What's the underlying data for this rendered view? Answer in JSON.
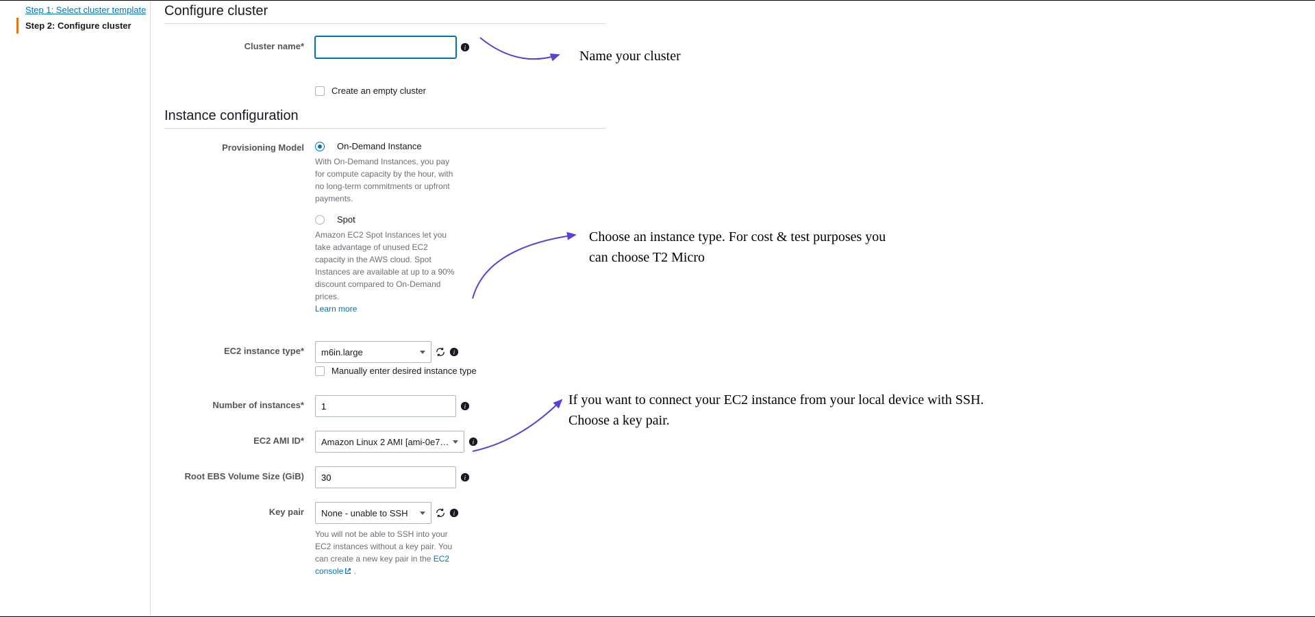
{
  "sidebar": {
    "step1": "Step 1: Select cluster template",
    "step2": "Step 2: Configure cluster"
  },
  "sections": {
    "configure": "Configure cluster",
    "instance": "Instance configuration"
  },
  "clusterName": {
    "label": "Cluster name*"
  },
  "emptyCluster": {
    "label": "Create an empty cluster"
  },
  "provisioning": {
    "label": "Provisioning Model",
    "onDemand": {
      "label": "On-Demand Instance",
      "help": "With On-Demand Instances, you pay for compute capacity by the hour, with no long-term commitments or upfront payments."
    },
    "spot": {
      "label": "Spot",
      "help": "Amazon EC2 Spot Instances let you take advantage of unused EC2 capacity in the AWS cloud. Spot Instances are available at up to a 90% discount compared to On-Demand prices."
    },
    "learnMore": "Learn more"
  },
  "ec2InstanceType": {
    "label": "EC2 instance type*",
    "value": "m6in.large",
    "manual": "Manually enter desired instance type"
  },
  "numberOfInstances": {
    "label": "Number of instances*",
    "value": "1"
  },
  "ec2AmiId": {
    "label": "EC2 AMI ID*",
    "value": "Amazon Linux 2 AMI [ami-0e72…"
  },
  "rootEbs": {
    "label": "Root EBS Volume Size (GiB)",
    "value": "30"
  },
  "keyPair": {
    "label": "Key pair",
    "value": "None - unable to SSH",
    "helpPrefix": "You will not be able to SSH into your EC2 instances without a key pair. You can create a new key pair in the ",
    "consoleLink": "EC2 console",
    "period": " ."
  },
  "annotations": {
    "name": "Name your cluster",
    "instance": "Choose an instance type. For cost & test purposes you can choose T2 Micro",
    "keypair": "If you want to connect your EC2 instance from your local device with SSH. Choose a key pair."
  }
}
